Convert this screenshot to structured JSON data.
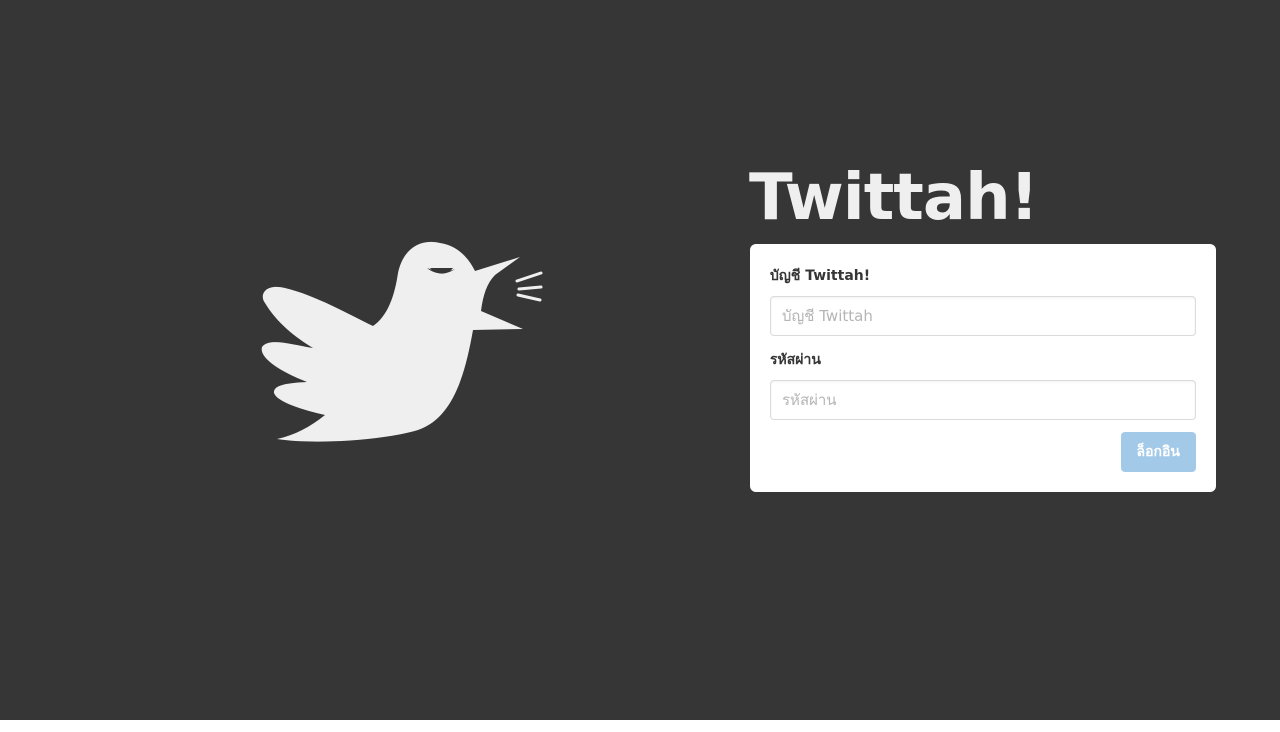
{
  "brand": {
    "title": "Twittah!",
    "logo_icon": "shouting-bird-icon",
    "logo_color": "#efefef"
  },
  "colors": {
    "background": "#363636",
    "card": "#ffffff",
    "button_disabled": "#a3c9e8"
  },
  "login_form": {
    "account_label": "บัญชี Twittah!",
    "account_placeholder": "บัญชี Twittah",
    "account_value": "",
    "password_label": "รหัสผ่าน",
    "password_placeholder": "รหัสผ่าน",
    "password_value": "",
    "submit_label": "ล็อกอิน",
    "submit_disabled": true
  }
}
